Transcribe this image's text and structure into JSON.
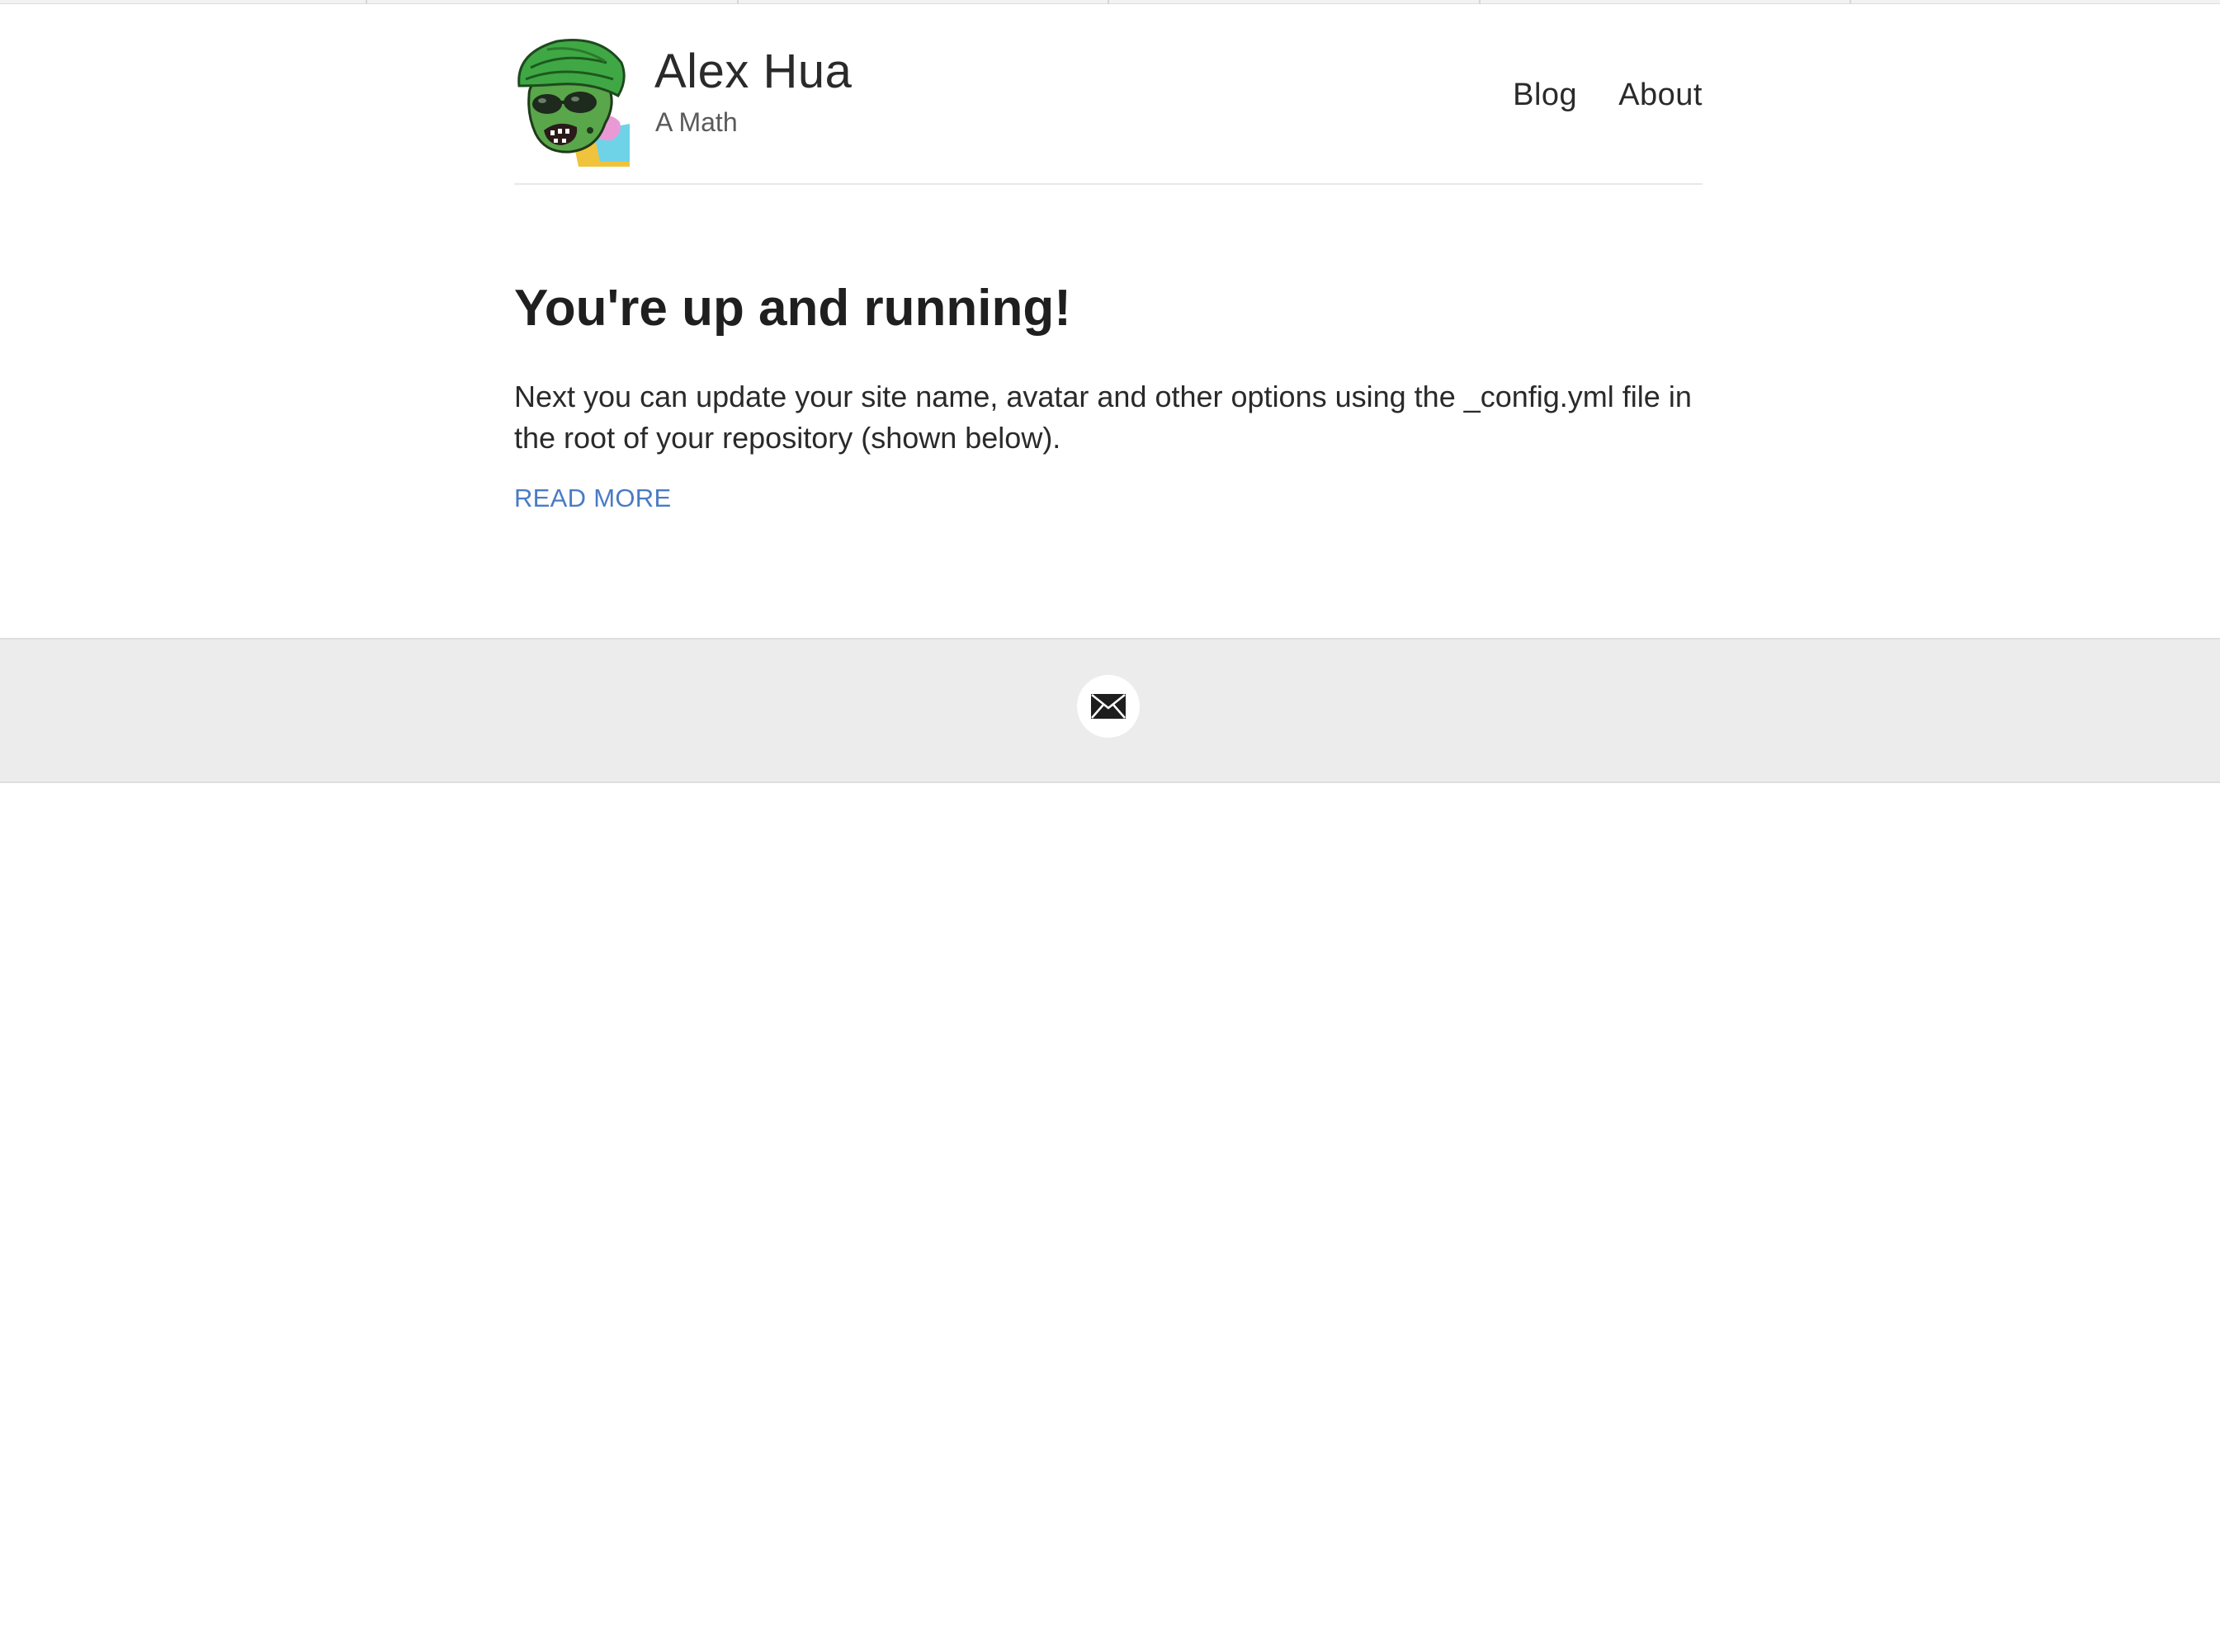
{
  "site": {
    "title": "Alex Hua",
    "description": "A Math"
  },
  "nav": {
    "items": [
      {
        "label": "Blog"
      },
      {
        "label": "About"
      }
    ]
  },
  "post": {
    "title": "You're up and running!",
    "excerpt": "Next you can update your site name, avatar and other options using the _config.yml file in the root of your repository (shown below).",
    "read_more_label": "READ MORE"
  },
  "footer": {
    "icons": [
      "envelope-icon"
    ]
  },
  "colors": {
    "link": "#4a7bc4",
    "footer_bg": "#ececec",
    "text": "#222222"
  }
}
